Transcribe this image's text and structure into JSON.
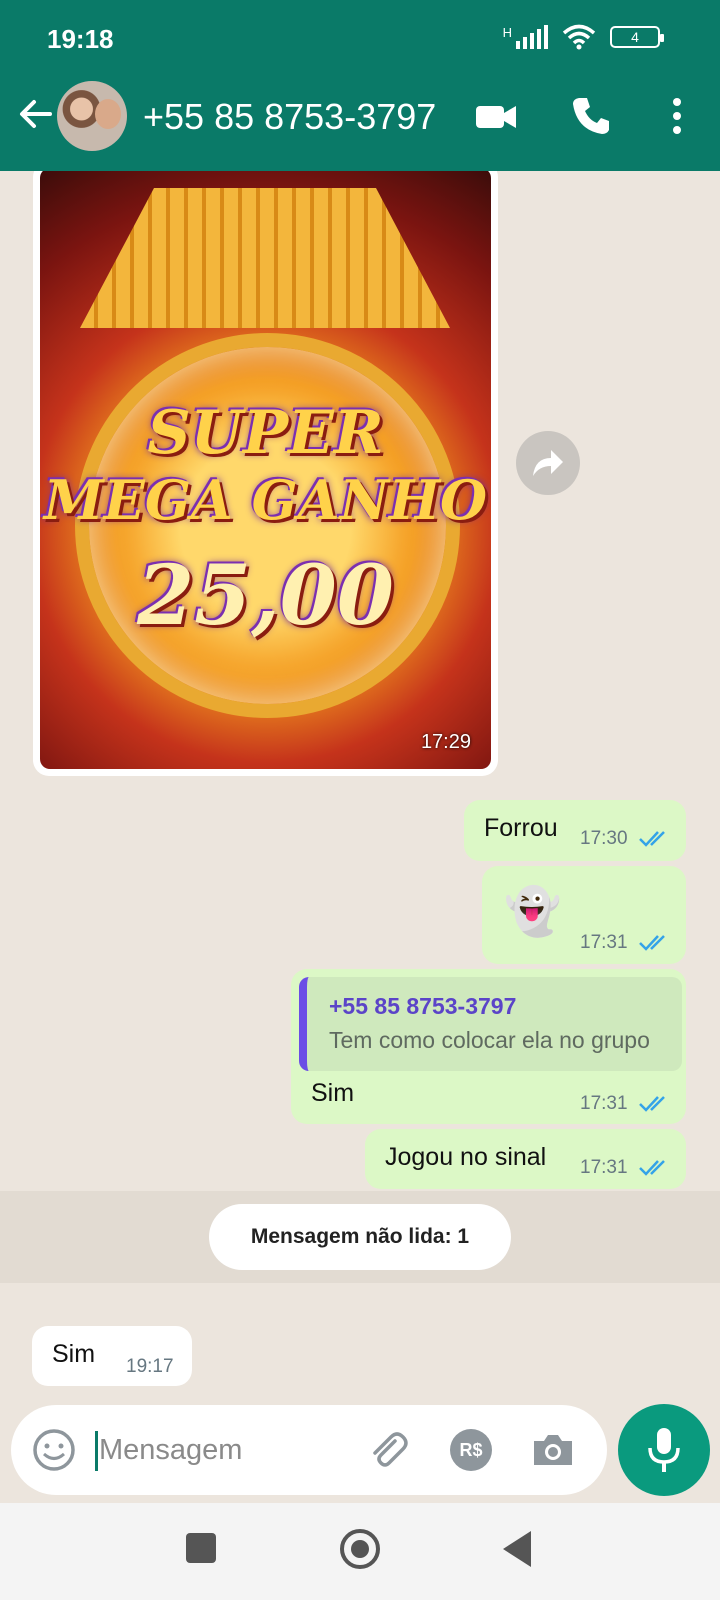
{
  "status_bar": {
    "time": "19:18",
    "network": "H",
    "battery": "4"
  },
  "header": {
    "contact_name": "+55 85 8753-3797",
    "back_icon": "arrow-left-icon",
    "video_icon": "video-camera-icon",
    "call_icon": "phone-icon",
    "menu_icon": "more-vert-icon"
  },
  "messages": [
    {
      "type": "image",
      "direction": "in",
      "image_text": [
        "SUPER",
        "MEGA GANHO",
        "25,00"
      ],
      "time": "17:29"
    },
    {
      "type": "text",
      "direction": "out",
      "text": "Forrou",
      "time": "17:30",
      "status": "read"
    },
    {
      "type": "emoji",
      "direction": "out",
      "text": "👻",
      "time": "17:31",
      "status": "read"
    },
    {
      "type": "reply",
      "direction": "out",
      "quoted_name": "+55 85 8753-3797",
      "quoted_text": "Tem como colocar ela no grupo",
      "text": "Sim",
      "time": "17:31",
      "status": "read"
    },
    {
      "type": "text",
      "direction": "out",
      "text": "Jogou no sinal",
      "time": "17:31",
      "status": "read"
    },
    {
      "type": "text",
      "direction": "in",
      "text": "Sim",
      "time": "19:17"
    }
  ],
  "unread_banner": "Mensagem não lida: 1",
  "input": {
    "placeholder": "Mensagem",
    "money_label": "R$"
  },
  "colors": {
    "header": "#0a7a68",
    "outgoing_bubble": "#dcf8c6",
    "incoming_bubble": "#ffffff",
    "read_ticks": "#34a3e8",
    "mic_button": "#0a9a7e"
  }
}
